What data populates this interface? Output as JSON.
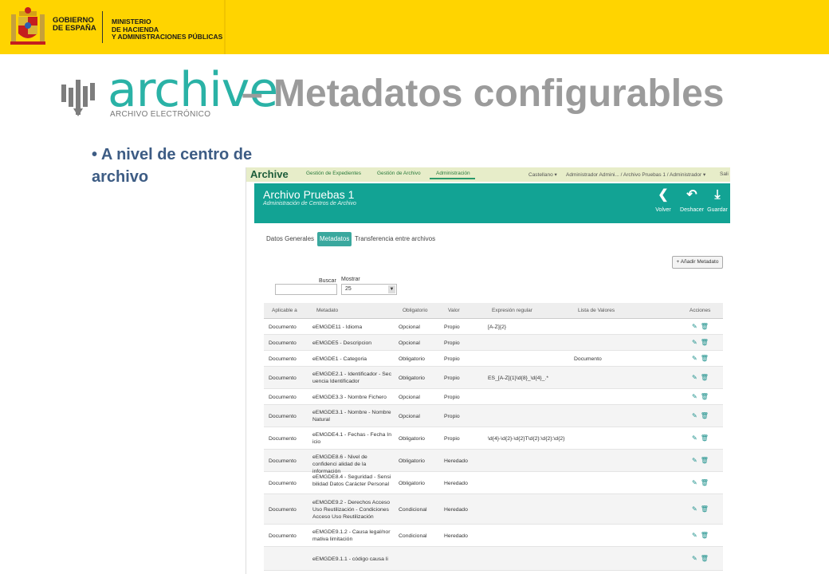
{
  "gov": {
    "line1": "GOBIERNO",
    "line2": "DE ESPAÑA",
    "min1": "MINISTERIO",
    "min2": "DE HACIENDA",
    "min3": "Y ADMINISTRACIONES PÚBLICAS"
  },
  "logo": {
    "word": "archive",
    "sub": "ARCHIVO ELECTRÓNICO"
  },
  "title": "– Metadatos configurables",
  "bullet": "• A nivel de centro de archivo",
  "app": {
    "brand": "Archive",
    "nav": [
      "Gestión de Expedientes",
      "Gestión de Archivo",
      "Administración"
    ],
    "lang": "Castellano ▾",
    "user": "Administrador Admini... / Archivo Pruebas 1 / Administrador ▾",
    "exit": "Sali",
    "header_title": "Archivo Pruebas 1",
    "header_sub": "Administración de Centros de Archivo",
    "buttons": [
      {
        "icon": "chevron-left",
        "glyph": "❮",
        "label": "Volver"
      },
      {
        "icon": "undo",
        "glyph": "↶",
        "label": "Deshacer"
      },
      {
        "icon": "save",
        "glyph": "⤓",
        "label": "Guardar"
      }
    ],
    "tabs": [
      "Datos Generales",
      "Metadatos",
      "Transferencia entre archivos"
    ],
    "active_tab": "Metadatos",
    "add_button": "+ Añadir Metadato",
    "search_label": "Buscar",
    "show_label": "Mostrar",
    "show_value": "25",
    "columns": [
      "Aplicable a",
      "Metadato",
      "Obligatorio",
      "Valor",
      "Expresión regular",
      "Lista de Valores",
      "Acciones"
    ],
    "rows": [
      {
        "apl": "Documento",
        "met": "eEMGDE11 - Idioma",
        "obl": "Opcional",
        "val": "Propio",
        "exp": "[A-Z]{2}",
        "lst": ""
      },
      {
        "apl": "Documento",
        "met": "eEMGDE5 - Descripcion",
        "obl": "Opcional",
        "val": "Propio",
        "exp": "",
        "lst": ""
      },
      {
        "apl": "Documento",
        "met": "eEMGDE1 - Categoria",
        "obl": "Obligatorio",
        "val": "Propio",
        "exp": "",
        "lst": "Documento"
      },
      {
        "apl": "Documento",
        "met": "eEMGDE2.1 - Identificador - Sec uencia Identificador",
        "obl": "Obligatorio",
        "val": "Propio",
        "exp": "ES_[A-Z]{1}\\d{8}_\\d{4}_.*",
        "lst": ""
      },
      {
        "apl": "Documento",
        "met": "eEMGDE3.3 - Nombre Fichero",
        "obl": "Opcional",
        "val": "Propio",
        "exp": "",
        "lst": ""
      },
      {
        "apl": "Documento",
        "met": "eEMGDE3.1 - Nombre - Nombre Natural",
        "obl": "Opcional",
        "val": "Propio",
        "exp": "",
        "lst": ""
      },
      {
        "apl": "Documento",
        "met": "eEMGDE4.1 - Fechas - Fecha In icio",
        "obl": "Obligatorio",
        "val": "Propio",
        "exp": "\\d{4}-\\d{2}-\\d{2}T\\d{2}:\\d{2}:\\d{2}",
        "lst": ""
      },
      {
        "apl": "Documento",
        "met": "eEMGDE8.6 - Nivel de confidenci alidad de la información",
        "obl": "Obligatorio",
        "val": "Heredado",
        "exp": "",
        "lst": ""
      },
      {
        "apl": "Documento",
        "met": "eEMGDE8.4 - Seguridad - Sensi bilidad Datos Carácter Personal",
        "obl": "Obligatorio",
        "val": "Heredado",
        "exp": "",
        "lst": ""
      },
      {
        "apl": "Documento",
        "met": "eEMGDE9.2 - Derechos Acceso Uso Reutilización - Condiciones Acceso Uso Reutilización",
        "obl": "Condicional",
        "val": "Heredado",
        "exp": "",
        "lst": ""
      },
      {
        "apl": "Documento",
        "met": "eEMGDE9.1.2 - Causa legal/nor mativa limitación",
        "obl": "Condicional",
        "val": "Heredado",
        "exp": "",
        "lst": ""
      },
      {
        "apl": "",
        "met": "eEMGDE9.1.1 - código causa li",
        "obl": "",
        "val": "",
        "exp": "",
        "lst": ""
      }
    ]
  },
  "colors": {
    "accent": "#12a394",
    "gov_yellow": "#ffd400",
    "title_gray": "#9b9b9b",
    "bullet_blue": "#3d5c84"
  }
}
